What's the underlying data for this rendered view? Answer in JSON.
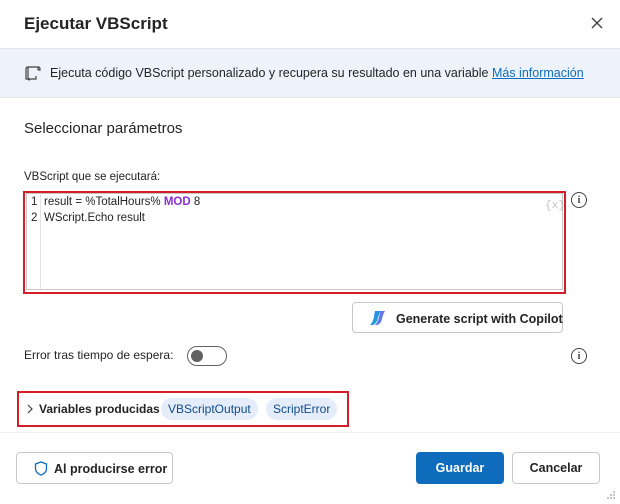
{
  "dialog": {
    "title": "Ejecutar VBScript",
    "close_icon": "close-icon"
  },
  "info_bar": {
    "icon": "script-icon",
    "text": "Ejecuta código VBScript personalizado y recupera su resultado en una variable",
    "link": "Más información"
  },
  "section": {
    "title": "Seleccionar parámetros"
  },
  "script_field": {
    "label": "VBScript que se ejecutará:",
    "lines": [
      {
        "number": "1",
        "before": "result = %TotalHours% ",
        "keyword": "MOD",
        "after": " 8"
      },
      {
        "number": "2",
        "before": "WScript.Echo result",
        "keyword": "",
        "after": ""
      }
    ],
    "variable_badge": "{x}",
    "info_icon": "info-icon"
  },
  "copilot": {
    "label": "Generate script with Copilot",
    "icon": "copilot-icon"
  },
  "timeout": {
    "label": "Error tras tiempo de espera:",
    "toggle_state": "off",
    "info_icon": "info-icon"
  },
  "variables": {
    "label": "Variables producidas",
    "items": [
      "VBScriptOutput",
      "ScriptError"
    ]
  },
  "footer": {
    "error_button": "Al producirse error",
    "save_button": "Guardar",
    "cancel_button": "Cancelar"
  },
  "colors": {
    "accent": "#0f6cbd",
    "highlight": "#d41f2a",
    "keyword": "#8a2fd1",
    "info_bar_bg": "#eef3fb",
    "pill_bg": "#e4edf9"
  }
}
